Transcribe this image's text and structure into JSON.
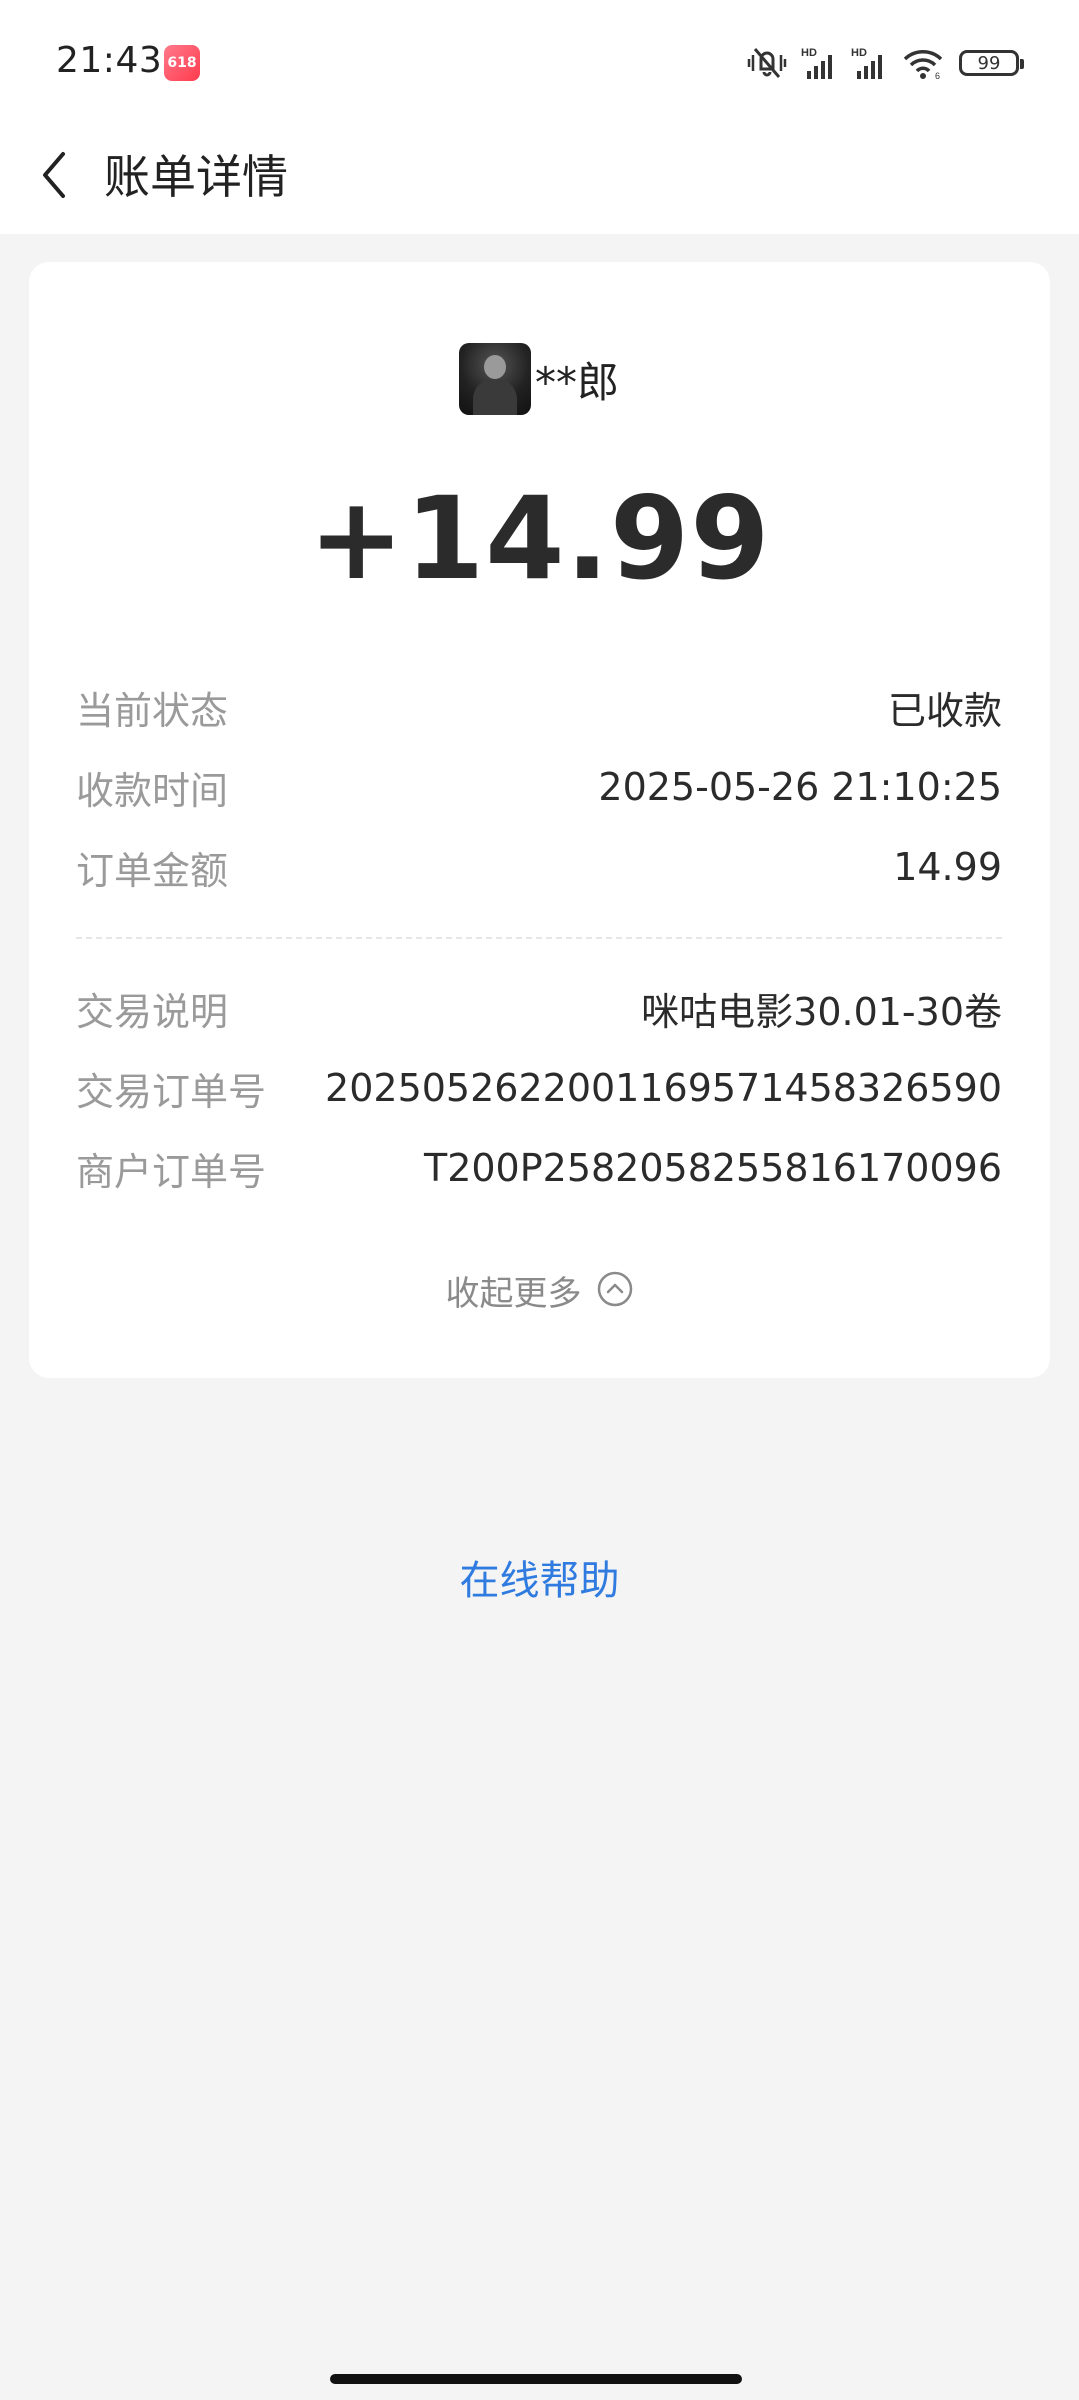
{
  "status_bar": {
    "time": "21:43",
    "app_badge_text": "618",
    "battery_level": "99",
    "icons": [
      "mute-vibrate-icon",
      "hd-signal-icon",
      "hd-signal-icon",
      "wifi-icon",
      "battery-icon"
    ]
  },
  "header": {
    "back_icon": "chevron-left-icon",
    "title": "账单详情"
  },
  "bill": {
    "payer_name": "**郎",
    "amount": "+14.99",
    "details": [
      {
        "label": "当前状态",
        "value": "已收款"
      },
      {
        "label": "收款时间",
        "value": "2025-05-26 21:10:25"
      },
      {
        "label": "订单金额",
        "value": "14.99"
      },
      {
        "label": "交易说明",
        "value": "咪咕电影30.01-30卷"
      },
      {
        "label": "交易订单号",
        "value": "2025052622001169571458326590"
      },
      {
        "label": "商户订单号",
        "value": "T200P2582058255816170096"
      }
    ],
    "collapse_label": "收起更多",
    "collapse_icon": "chevron-up-circle-icon"
  },
  "help": {
    "label": "在线帮助"
  },
  "colors": {
    "link": "#2f7be0",
    "label_gray": "#9a9a9a",
    "background": "#f4f4f4"
  }
}
